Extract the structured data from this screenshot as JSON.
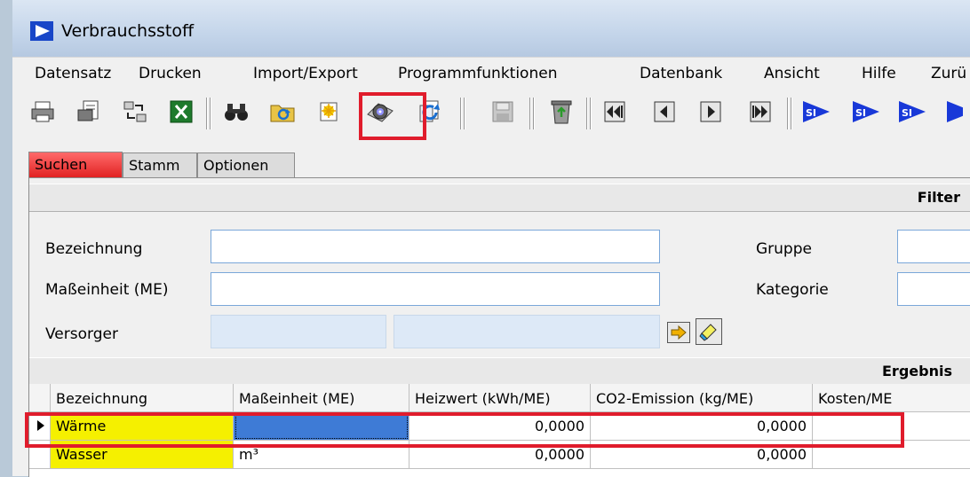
{
  "window": {
    "title": "Verbrauchsstoff"
  },
  "menu": [
    "Datensatz",
    "Drucken",
    "Import/Export",
    "Programmfunktionen",
    "Datenbank",
    "Ansicht",
    "Hilfe",
    "Zurü"
  ],
  "toolbar": {
    "icons": [
      "print-icon",
      "print-preview-icon",
      "transfer-icon",
      "excel-icon",
      "binoculars-icon",
      "folder-refresh-icon",
      "new-record-icon",
      "settings-cd-icon",
      "copy-refresh-icon",
      "save-icon",
      "recycle-bin-icon",
      "first-record-icon",
      "previous-record-icon",
      "next-record-icon",
      "last-record-icon",
      "si-arrow-icon"
    ],
    "si_label": "SI"
  },
  "tabs": [
    "Suchen",
    "Stamm",
    "Optionen"
  ],
  "filter": {
    "header": "Filter",
    "labels": {
      "bezeichnung": "Bezeichnung",
      "masseinheit": "Maßeinheit (ME)",
      "versorger": "Versorger",
      "gruppe": "Gruppe",
      "kategorie": "Kategorie"
    }
  },
  "results": {
    "header": "Ergebnis",
    "columns": [
      "Bezeichnung",
      "Maßeinheit (ME)",
      "Heizwert (kWh/ME)",
      "CO2-Emission (kg/ME)",
      "Kosten/ME"
    ],
    "rows": [
      [
        "Wärme",
        "",
        "0,0000",
        "0,0000",
        ""
      ],
      [
        "Wasser",
        "m³",
        "0,0000",
        "0,0000",
        ""
      ]
    ]
  },
  "colors": {
    "highlight": "#e01c2c",
    "yellow_cell": "#f5f000",
    "selected_cell": "#3e7bd6"
  }
}
